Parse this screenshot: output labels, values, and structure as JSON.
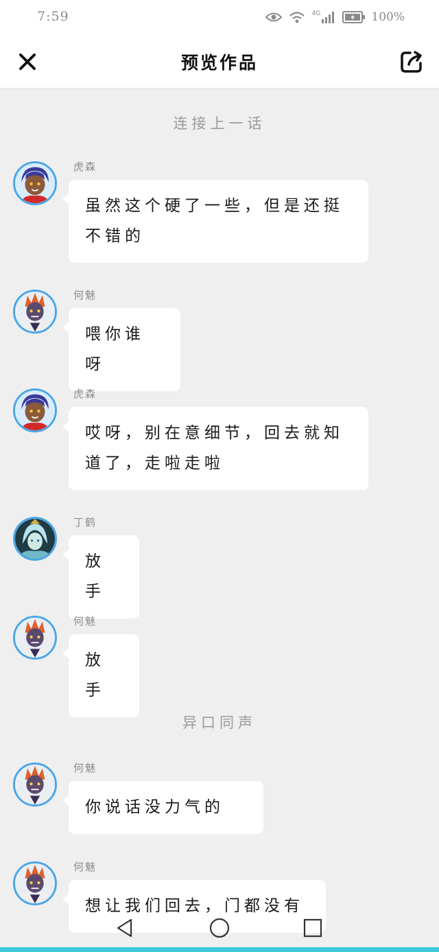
{
  "status_bar": {
    "time": "7:59",
    "network": "4G",
    "battery_percent": "100%",
    "icons": [
      "eye-icon",
      "wifi-icon",
      "signal-icon",
      "battery-icon"
    ]
  },
  "header": {
    "title": "预览作品",
    "close_icon": "close-icon",
    "share_icon": "share-icon"
  },
  "dividers": {
    "continue_previous": "连接上一话",
    "in_unison": "异口同声"
  },
  "messages": [
    {
      "sender": "虎森",
      "text": "虽然这个硬了一些，但是还挺不错的",
      "avatar": "hu-sen"
    },
    {
      "sender": "何魅",
      "text": "喂你谁呀",
      "avatar": "he-mei"
    },
    {
      "sender": "虎森",
      "text": "哎呀，别在意细节，回去就知道了，走啦走啦",
      "avatar": "hu-sen"
    },
    {
      "sender": "丁鹤",
      "text": "放手",
      "avatar": "ding-he"
    },
    {
      "sender": "何魅",
      "text": "放手",
      "avatar": "he-mei"
    },
    {
      "sender": "何魅",
      "text": "你说话没力气的",
      "avatar": "he-mei"
    },
    {
      "sender": "何魅",
      "text": "想让我们回去，门都没有",
      "avatar": "he-mei"
    }
  ],
  "colors": {
    "background": "#efefef",
    "bubble": "#ffffff",
    "avatar_ring": "#4aa6e8",
    "accent": "#3ec9d6"
  },
  "nav_bar": {
    "icons": [
      "back-icon",
      "home-icon",
      "recents-icon"
    ]
  }
}
